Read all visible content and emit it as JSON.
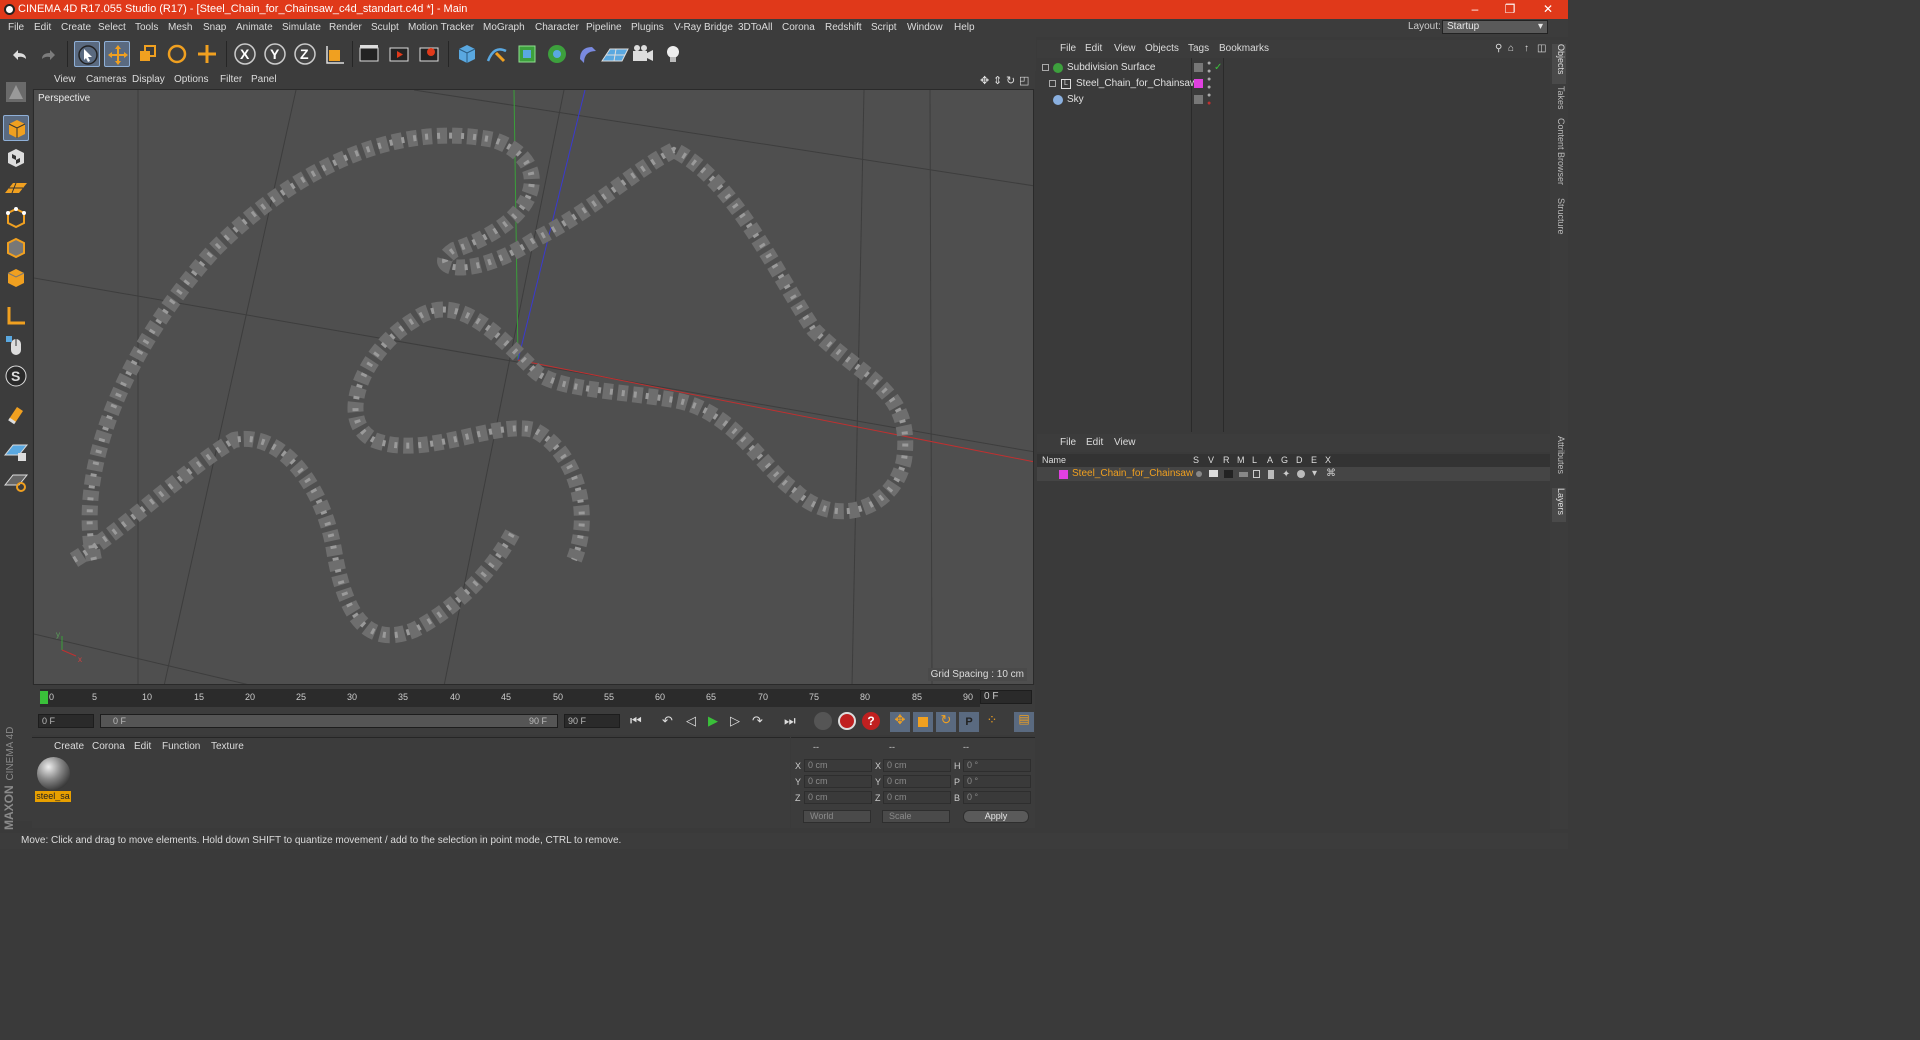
{
  "window": {
    "title": "CINEMA 4D R17.055 Studio (R17) - [Steel_Chain_for_Chainsaw_c4d_standart.c4d *] - Main",
    "minimize": "–",
    "restore": "❐",
    "close": "✕"
  },
  "menu": [
    "File",
    "Edit",
    "Create",
    "Select",
    "Tools",
    "Mesh",
    "Snap",
    "Animate",
    "Simulate",
    "Render",
    "Sculpt",
    "Motion Tracker",
    "MoGraph",
    "Character",
    "Pipeline",
    "Plugins",
    "V-Ray Bridge",
    "3DToAll",
    "Corona",
    "Redshift",
    "Script",
    "Window",
    "Help"
  ],
  "layout": {
    "label": "Layout:",
    "value": "Startup"
  },
  "toolbar": {
    "axis_x": "X",
    "axis_y": "Y",
    "axis_z": "Z"
  },
  "viewport": {
    "menu": [
      "View",
      "Cameras",
      "Display",
      "Options",
      "Filter",
      "Panel"
    ],
    "label": "Perspective",
    "grid_spacing": "Grid Spacing : 10 cm",
    "axis_x": "x",
    "axis_y": "y"
  },
  "timeline": {
    "ticks": [
      "0",
      "5",
      "10",
      "15",
      "20",
      "25",
      "30",
      "35",
      "40",
      "45",
      "50",
      "55",
      "60",
      "65",
      "70",
      "75",
      "80",
      "85",
      "90"
    ],
    "current": "0 F",
    "start": "0 F",
    "range_start": "0 F",
    "range_end": "90 F",
    "end": "90 F"
  },
  "material_panel": {
    "menu": [
      "Create",
      "Corona",
      "Edit",
      "Function",
      "Texture"
    ],
    "material_name": "steel_sa"
  },
  "coords": {
    "header_dashes": [
      "--",
      "--",
      "--"
    ],
    "rows": [
      {
        "l1": "X",
        "v1": "0 cm",
        "l2": "X",
        "v2": "0 cm",
        "l3": "H",
        "v3": "0 °"
      },
      {
        "l1": "Y",
        "v1": "0 cm",
        "l2": "Y",
        "v2": "0 cm",
        "l3": "P",
        "v3": "0 °"
      },
      {
        "l1": "Z",
        "v1": "0 cm",
        "l2": "Z",
        "v2": "0 cm",
        "l3": "B",
        "v3": "0 °"
      }
    ],
    "mode": "World",
    "scale": "Scale",
    "apply": "Apply"
  },
  "object_manager": {
    "menu": [
      "File",
      "Edit",
      "View",
      "Objects",
      "Tags",
      "Bookmarks"
    ],
    "objects": [
      {
        "name": "Subdivision Surface"
      },
      {
        "name": "Steel_Chain_for_Chainsaw"
      },
      {
        "name": "Sky"
      }
    ]
  },
  "layer_manager": {
    "menu": [
      "File",
      "Edit",
      "View"
    ],
    "columns": [
      "Name",
      "S",
      "V",
      "R",
      "M",
      "L",
      "A",
      "G",
      "D",
      "E",
      "X"
    ],
    "layer_name": "Steel_Chain_for_Chainsaw",
    "layer_color": "#e040e0"
  },
  "right_tabs": [
    "Objects",
    "Takes",
    "Content Browser",
    "Structure",
    "Attributes",
    "Layers"
  ],
  "status": "Move: Click and drag to move elements. Hold down SHIFT to quantize movement / add to the selection in point mode, CTRL to remove.",
  "logo": {
    "maxon": "MAXON",
    "product": "CINEMA 4D"
  },
  "colors": {
    "accent": "#e0391a",
    "selected": "#f0a020",
    "active_tool": "#5a6a80"
  }
}
